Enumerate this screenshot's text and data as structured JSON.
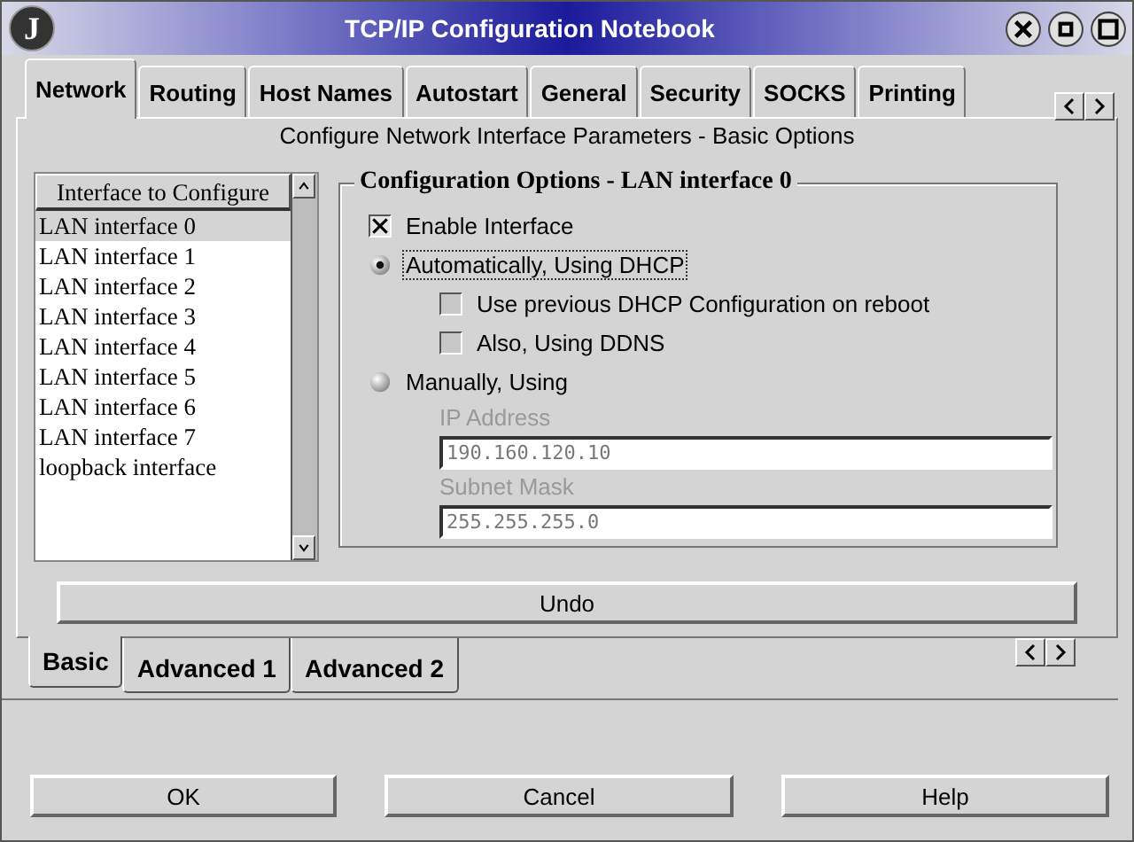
{
  "window": {
    "title": "TCP/IP Configuration Notebook",
    "app_letter": "J"
  },
  "tabs": [
    {
      "label": "Network",
      "selected": true
    },
    {
      "label": "Routing",
      "selected": false
    },
    {
      "label": "Host Names",
      "selected": false
    },
    {
      "label": "Autostart",
      "selected": false
    },
    {
      "label": "General",
      "selected": false
    },
    {
      "label": "Security",
      "selected": false
    },
    {
      "label": "SOCKS",
      "selected": false
    },
    {
      "label": "Printing",
      "selected": false
    }
  ],
  "page_heading": "Configure Network Interface Parameters - Basic Options",
  "interface_list": {
    "header": "Interface to Configure",
    "items": [
      {
        "label": "LAN interface 0",
        "selected": true
      },
      {
        "label": "LAN interface 1",
        "selected": false
      },
      {
        "label": "LAN interface 2",
        "selected": false
      },
      {
        "label": "LAN interface 3",
        "selected": false
      },
      {
        "label": "LAN interface 4",
        "selected": false
      },
      {
        "label": "LAN interface 5",
        "selected": false
      },
      {
        "label": "LAN interface 6",
        "selected": false
      },
      {
        "label": "LAN interface 7",
        "selected": false
      },
      {
        "label": "loopback interface",
        "selected": false
      }
    ]
  },
  "options": {
    "title": "Configuration Options - LAN interface 0",
    "items": [
      {
        "kind": "checkbox",
        "label": "Enable Interface",
        "checked": true,
        "indent": false
      },
      {
        "kind": "radio",
        "label": "Automatically, Using DHCP",
        "selected": true,
        "focused": true
      },
      {
        "kind": "checkbox",
        "label": "Use previous DHCP Configuration on reboot",
        "checked": false,
        "indent": true
      },
      {
        "kind": "checkbox",
        "label": "Also, Using DDNS",
        "checked": false,
        "indent": true
      },
      {
        "kind": "radio",
        "label": "Manually, Using",
        "selected": false,
        "focused": false
      },
      {
        "kind": "field",
        "label": "IP Address",
        "value": "190.160.120.10",
        "disabled": true
      },
      {
        "kind": "field",
        "label": "Subnet Mask",
        "value": "255.255.255.0",
        "disabled": true
      }
    ]
  },
  "undo_button": "Undo",
  "subtabs": [
    {
      "label": "Basic",
      "selected": true
    },
    {
      "label": "Advanced 1",
      "selected": false
    },
    {
      "label": "Advanced 2",
      "selected": false
    }
  ],
  "buttons": [
    "OK",
    "Cancel",
    "Help"
  ]
}
